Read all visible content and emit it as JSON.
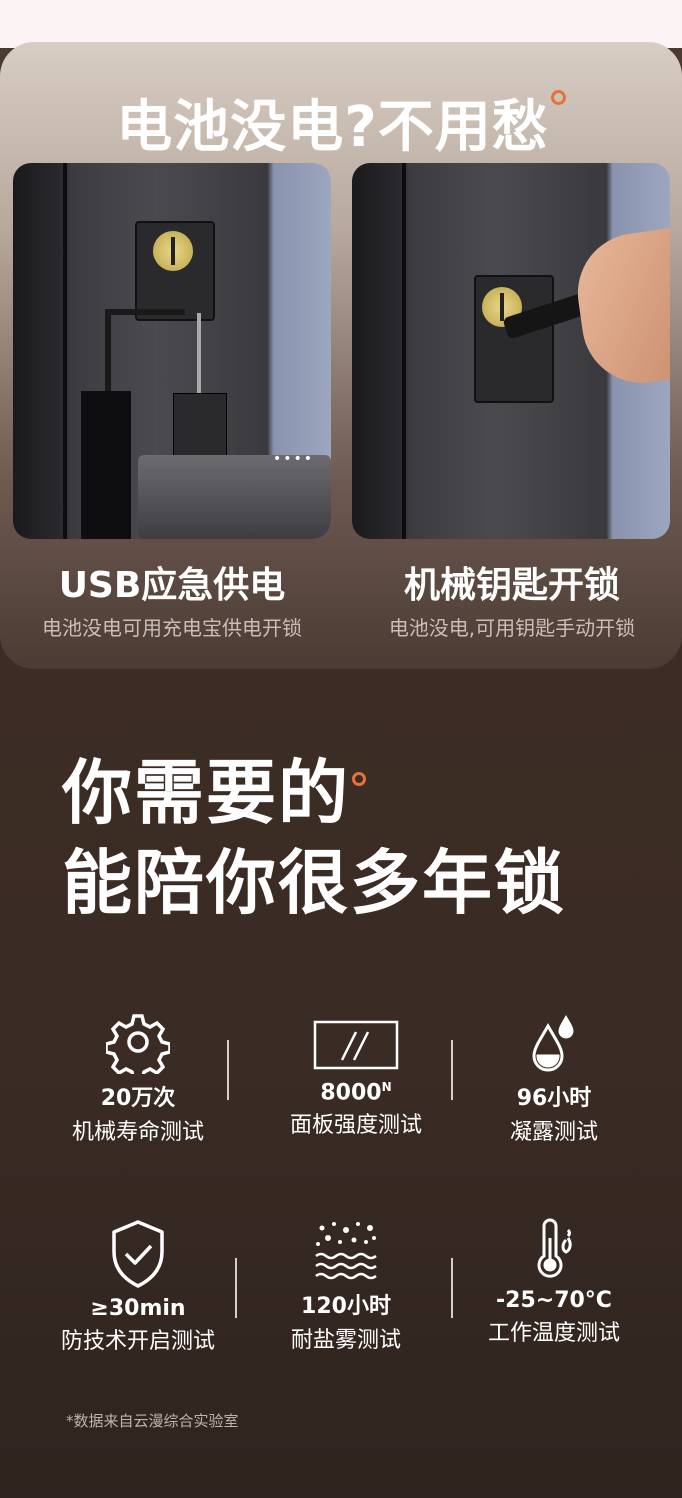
{
  "hero": {
    "title": "电池没电?不用愁"
  },
  "cards": [
    {
      "title": "USB应急供电",
      "subtitle": "电池没电可用充电宝供电开锁"
    },
    {
      "title": "机械钥匙开锁",
      "subtitle": "电池没电,可用钥匙手动开锁"
    }
  ],
  "headline": {
    "line1": "你需要的",
    "line2": "能陪你很多年锁"
  },
  "stats": [
    {
      "value": "20万次",
      "label": "机械寿命测试",
      "icon": "gear-icon"
    },
    {
      "value": "8000",
      "value_sup": "N",
      "label": "面板强度测试",
      "icon": "panel-icon"
    },
    {
      "value": "96小时",
      "label": "凝露测试",
      "icon": "water-drop-icon"
    },
    {
      "value": "≥30min",
      "label": "防技术开启测试",
      "icon": "shield-check-icon"
    },
    {
      "value": "120小时",
      "label": "耐盐雾测试",
      "icon": "salt-fog-icon"
    },
    {
      "value": "-25~70°C",
      "label": "工作温度测试",
      "icon": "thermometer-icon"
    }
  ],
  "footnote": "*数据来自云漫综合实验室",
  "colors": {
    "accent": "#e2733a",
    "background": "#3a2b24",
    "top_strip": "#fbf3f4"
  }
}
